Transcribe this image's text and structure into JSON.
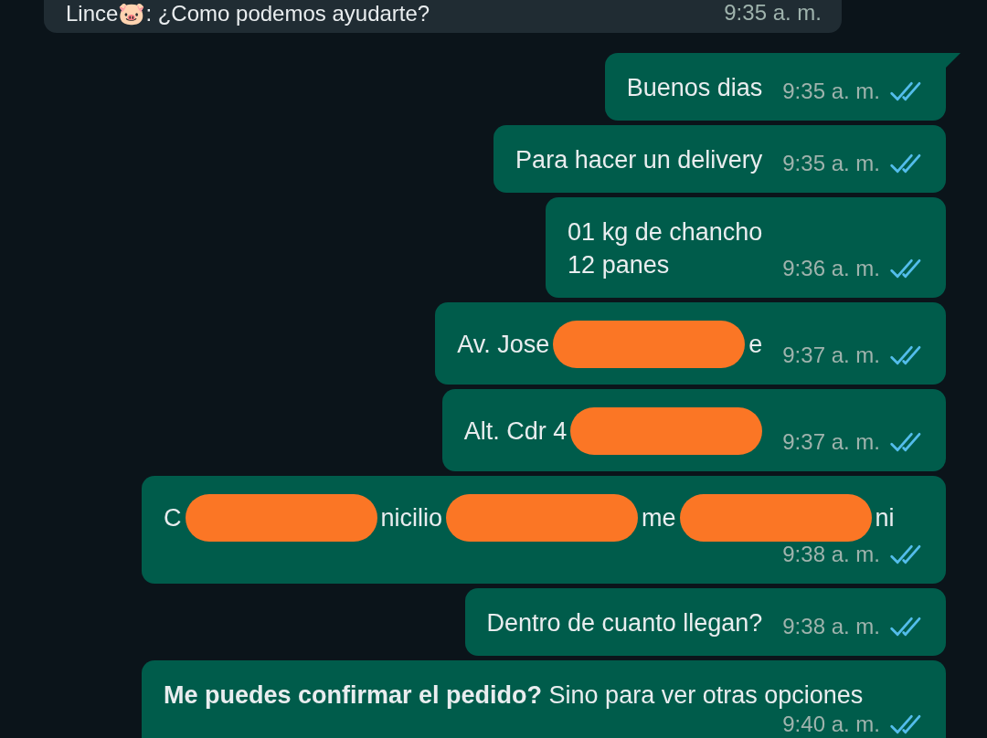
{
  "messages": [
    {
      "kind": "incoming",
      "text": "Lince🐷: ¿Como podemos ayudarte?",
      "time": "9:35 a. m."
    },
    {
      "kind": "outgoing",
      "tail": true,
      "parts": [
        {
          "kind": "text",
          "text": "Buenos dias"
        }
      ],
      "time": "9:35 a. m.",
      "read": true
    },
    {
      "kind": "outgoing",
      "parts": [
        {
          "kind": "text",
          "text": "Para hacer un delivery"
        }
      ],
      "time": "9:35 a. m.",
      "read": true
    },
    {
      "kind": "outgoing",
      "parts": [
        {
          "kind": "text",
          "text": "01 kg de chancho\n12 panes"
        }
      ],
      "time": "9:36 a. m.",
      "read": true
    },
    {
      "kind": "outgoing",
      "parts": [
        {
          "kind": "text",
          "text": "Av. Jose"
        },
        {
          "kind": "redaction"
        },
        {
          "kind": "text",
          "text": "e"
        }
      ],
      "time": "9:37 a. m.",
      "read": true
    },
    {
      "kind": "outgoing",
      "parts": [
        {
          "kind": "text",
          "text": "Alt. Cdr 4"
        },
        {
          "kind": "redaction"
        }
      ],
      "time": "9:37 a. m.",
      "read": true
    },
    {
      "kind": "outgoing",
      "parts": [
        {
          "kind": "text",
          "text": "C"
        },
        {
          "kind": "redaction"
        },
        {
          "kind": "text",
          "text": "nicilio"
        },
        {
          "kind": "redaction"
        },
        {
          "kind": "text",
          "text": "me"
        },
        {
          "kind": "redaction"
        },
        {
          "kind": "text",
          "text": "ni"
        }
      ],
      "time": "9:38 a. m.",
      "read": true
    },
    {
      "kind": "outgoing",
      "parts": [
        {
          "kind": "text",
          "text": "Dentro de cuanto llegan?"
        }
      ],
      "time": "9:38 a. m.",
      "read": true
    },
    {
      "kind": "outgoing",
      "parts": [
        {
          "kind": "text",
          "text": "**Me puedes confirmar el pedido?** Sino para ver otras opciones"
        }
      ],
      "time": "9:40 a. m.",
      "read": true
    }
  ]
}
